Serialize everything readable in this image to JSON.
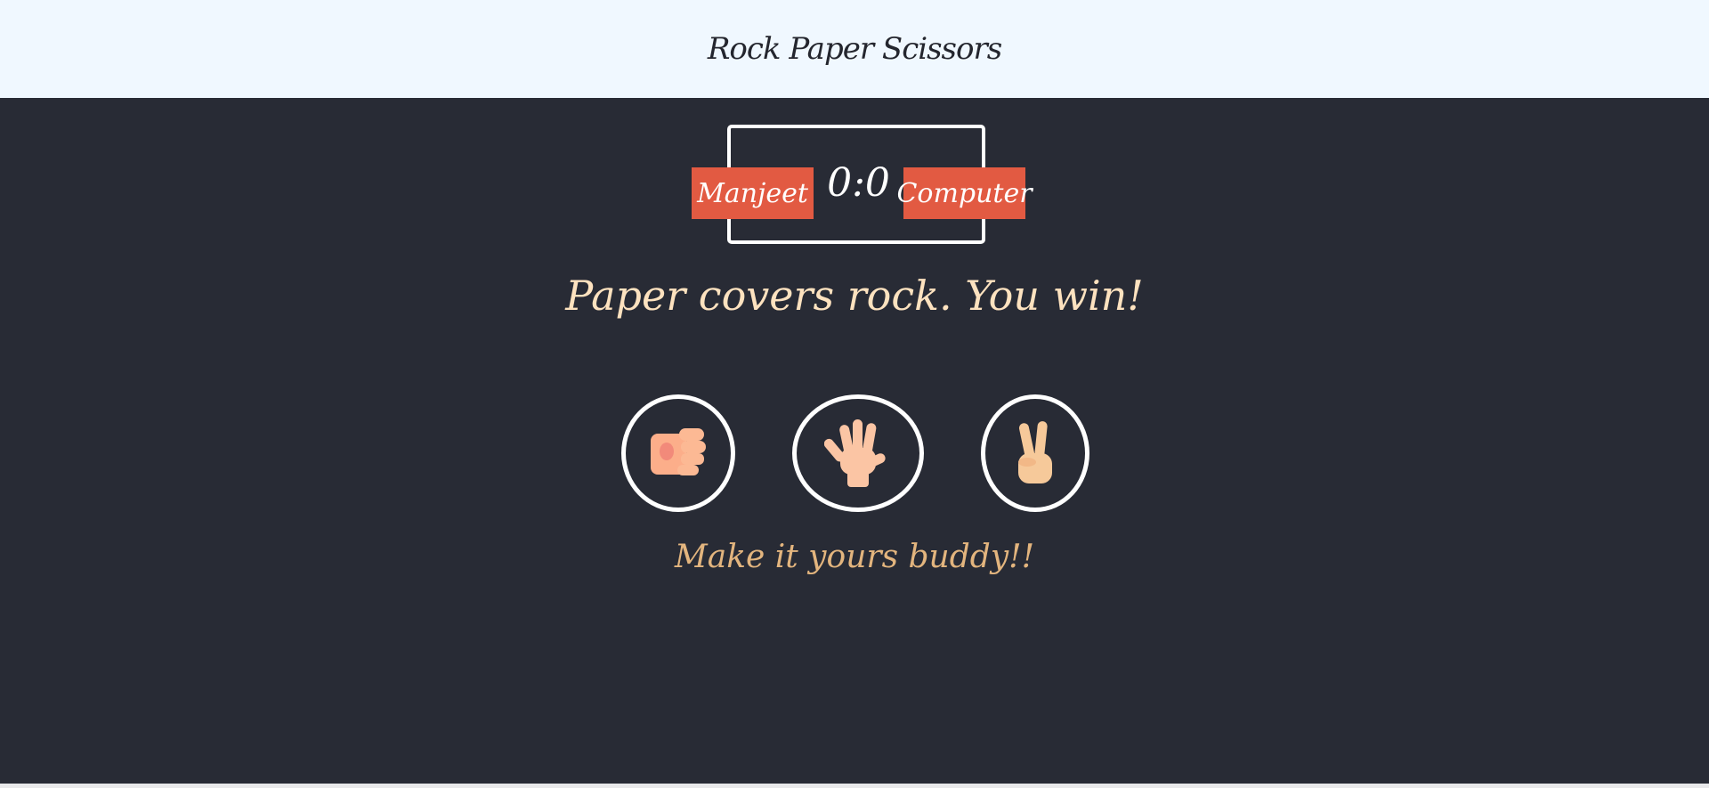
{
  "header": {
    "title": "Rock Paper Scissors"
  },
  "scoreboard": {
    "user_label": "Manjeet",
    "computer_label": "Computer",
    "score": "0:0",
    "user_score": 0,
    "computer_score": 0
  },
  "result": {
    "message": "Paper covers rock. You win!"
  },
  "choices": [
    {
      "id": "rock",
      "icon": "fist-icon"
    },
    {
      "id": "paper",
      "icon": "open-hand-icon"
    },
    {
      "id": "scissors",
      "icon": "victory-hand-icon"
    }
  ],
  "hint": {
    "text": "Make it yours buddy!!"
  },
  "colors": {
    "header_bg": "#f0f8ff",
    "body_bg": "#282b35",
    "badge": "#e25a42",
    "result_text": "#fde2bf",
    "hint_text": "#e3b57e"
  }
}
